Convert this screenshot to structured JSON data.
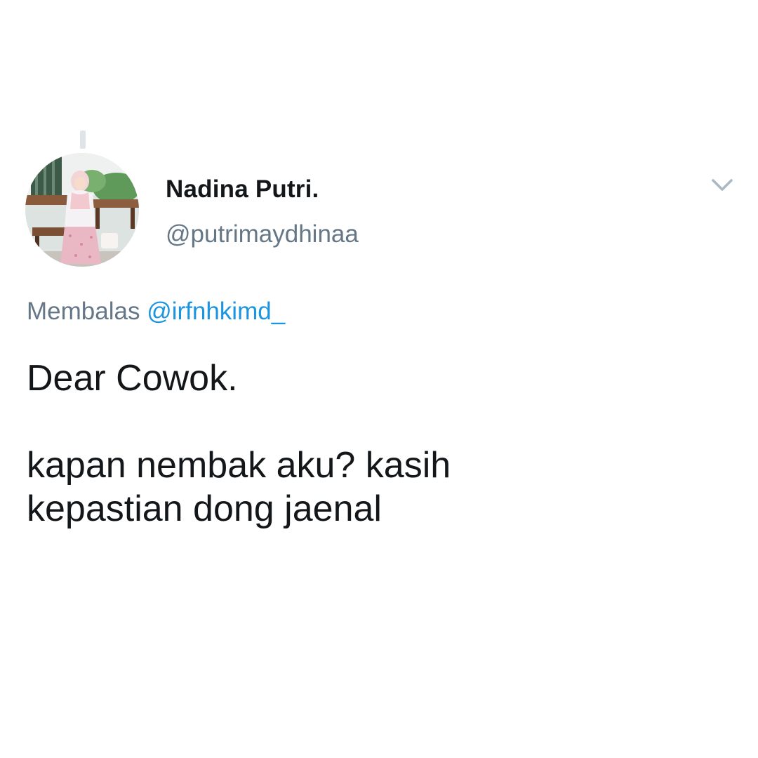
{
  "tweet": {
    "author": {
      "display_name": "Nadina Putri.",
      "handle": "@putrimaydhinaa",
      "avatar_icon": "profile-photo"
    },
    "reply_context": {
      "prefix": "Membalas",
      "mention": "@irfnhkimd_"
    },
    "text": "Dear Cowok.\n\nkapan nembak aku? kasih\nkepastian dong jaenal",
    "menu_icon": "chevron-down-icon"
  },
  "colors": {
    "text_primary": "#14171a",
    "text_secondary": "#657786",
    "link": "#1b95e0",
    "thread_line": "#dfe4e8"
  }
}
